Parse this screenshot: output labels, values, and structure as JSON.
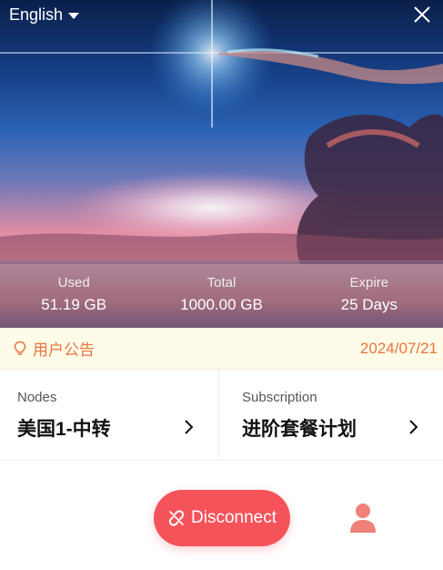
{
  "header": {
    "language": "English"
  },
  "stats": [
    {
      "label": "Used",
      "value": "51.19 GB"
    },
    {
      "label": "Total",
      "value": "1000.00 GB"
    },
    {
      "label": "Expire",
      "value": "25 Days"
    }
  ],
  "notice": {
    "title": "用户公告",
    "date": "2024/07/21"
  },
  "nodes": {
    "label": "Nodes",
    "value": "美国1-中转"
  },
  "subscription": {
    "label": "Subscription",
    "value": "进阶套餐计划"
  },
  "connection": {
    "button_label": "Disconnect"
  },
  "colors": {
    "accent": "#f5535a",
    "notice_text": "#e8753a",
    "notice_bg": "#fffbe9"
  },
  "icons": {
    "language_caret": "caret-down-icon",
    "close": "close-icon",
    "notice": "lightbulb-icon",
    "chevron": "chevron-right-icon",
    "disconnect": "link-broken-icon",
    "user": "user-icon"
  }
}
